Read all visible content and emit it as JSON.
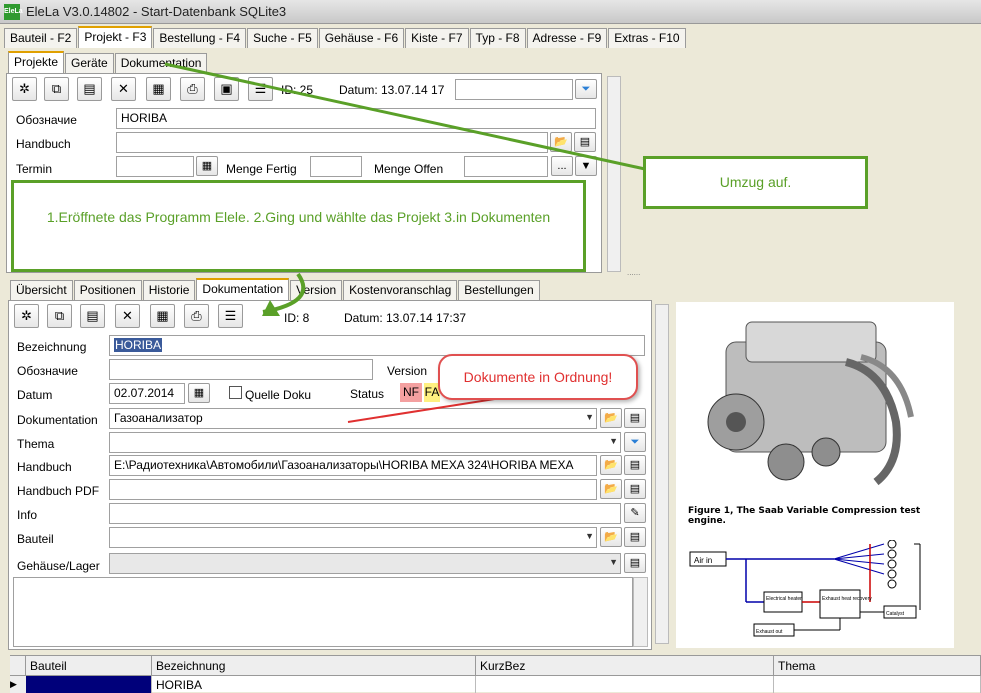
{
  "window": {
    "logo": "EleLa",
    "title": "EleLa V3.0.14802  - Start-Datenbank SQLite3"
  },
  "main_tabs": [
    "Bauteil - F2",
    "Projekt - F3",
    "Bestellung - F4",
    "Suche - F5",
    "Gehäuse - F6",
    "Kiste - F7",
    "Typ - F8",
    "Adresse - F9",
    "Extras - F10"
  ],
  "sub_tabs": [
    "Projekte",
    "Geräte",
    "Dokumentation"
  ],
  "top": {
    "id_label": "ID: 25",
    "datum_label": "Datum: 13.07.14 17",
    "oboz_label": "Обозначие",
    "oboz_value": "HORIBA",
    "handbuch_label": "Handbuch",
    "termin_label": "Termin",
    "menge_fertig_label": "Menge Fertig",
    "menge_offen_label": "Menge Offen",
    "ellipsis": "..."
  },
  "bottom_tabs": [
    "Übersicht",
    "Positionen",
    "Historie",
    "Dokumentation",
    "Version",
    "Kostenvoranschlag",
    "Bestellungen"
  ],
  "doc": {
    "id_label": "ID: 8",
    "datum_label": "Datum: 13.07.14 17:37",
    "bezeichnung_label": "Bezeichnung",
    "bezeichnung_value": "HORIBA",
    "oboz_label": "Обозначие",
    "version_label": "Version",
    "datum2_label": "Datum",
    "datum2_value": "02.07.2014",
    "quelle_label": "Quelle Doku",
    "status_label": "Status",
    "status_nf": "NF",
    "status_fa": "FA",
    "dokumentation_label": "Dokumentation",
    "dokumentation_value": "Газоанализатор",
    "thema_label": "Thema",
    "handbuch_label": "Handbuch",
    "handbuch_value": "E:\\Радиотехника\\Автомобили\\Газоанализаторы\\HORIBA MEXA 324\\HORIBA MEXA",
    "handbuch_pdf_label": "Handbuch PDF",
    "info_label": "Info",
    "bauteil_label": "Bauteil",
    "gehaeuse_label": "Gehäuse/Lager"
  },
  "grid": {
    "columns": [
      "Bauteil",
      "Bezeichnung",
      "KurzBez",
      "Thema"
    ],
    "rows": [
      [
        "",
        "HORIBA",
        "",
        ""
      ]
    ]
  },
  "preview": {
    "figure_caption": "Figure 1, The Saab Variable Compression test engine.",
    "diagram_labels": [
      "Air in",
      "Electrical heater",
      "Exhaust heat recovery",
      "Catalyst",
      "Exhaust out"
    ]
  },
  "annotations": {
    "green_main": "1.Eröffnete das Programm Elele. 2.Ging und wählte das Projekt 3.in Dokumenten",
    "green_right": "Umzug auf.",
    "red": "Dokumente in Ordnung!"
  }
}
